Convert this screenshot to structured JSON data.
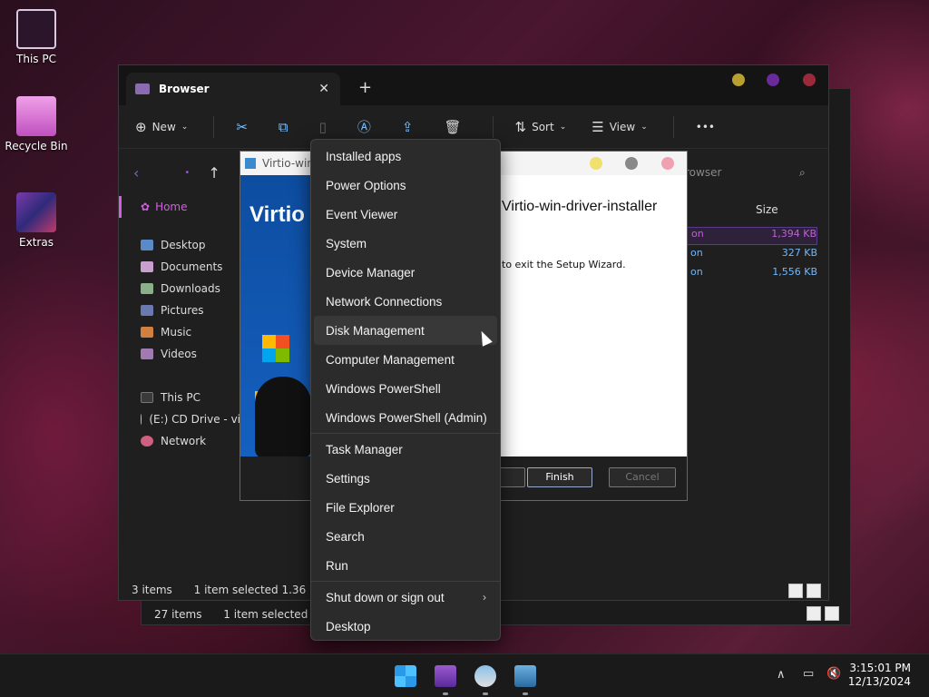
{
  "desktop": {
    "icons": [
      {
        "label": "This PC"
      },
      {
        "label": "Recycle Bin"
      },
      {
        "label": "Extras"
      }
    ]
  },
  "back_window": {
    "status_items": "27 items",
    "status_selected": "1 item selected 4.65"
  },
  "explorer": {
    "tab_title": "Browser",
    "new_tab": "+",
    "toolbar": {
      "new_label": "New",
      "sort_label": "Sort",
      "view_label": "View",
      "more_label": "•••"
    },
    "search_placeholder": "rowser",
    "sidebar": {
      "home": "Home",
      "items": [
        "Desktop",
        "Documents",
        "Downloads",
        "Pictures",
        "Music",
        "Videos"
      ],
      "drives": [
        "This PC",
        "(E:) CD Drive - vi",
        "Network"
      ]
    },
    "columns": {
      "size": "Size"
    },
    "files": [
      {
        "type": "on",
        "size": "1,394 KB",
        "selected": true
      },
      {
        "type": "on",
        "size": "327 KB",
        "selected": false
      },
      {
        "type": "on",
        "size": "1,556 KB",
        "selected": false
      }
    ],
    "status_items": "3 items",
    "status_selected": "1 item selected  1.36 MB"
  },
  "setup": {
    "title": "Virtio-win",
    "brand": "Virtio",
    "heading": "Virtio-win-driver-installer",
    "body": "to exit the Setup Wizard.",
    "finish": "Finish",
    "cancel": "Cancel"
  },
  "context_menu": {
    "items": [
      "Installed apps",
      "Power Options",
      "Event Viewer",
      "System",
      "Device Manager",
      "Network Connections",
      "Disk Management",
      "Computer Management",
      "Windows PowerShell",
      "Windows PowerShell (Admin)",
      "Task Manager",
      "Settings",
      "File Explorer",
      "Search",
      "Run",
      "Shut down or sign out",
      "Desktop"
    ],
    "hovered": "Disk Management"
  },
  "taskbar": {
    "time": "3:15:01 PM",
    "date": "12/13/2024"
  }
}
